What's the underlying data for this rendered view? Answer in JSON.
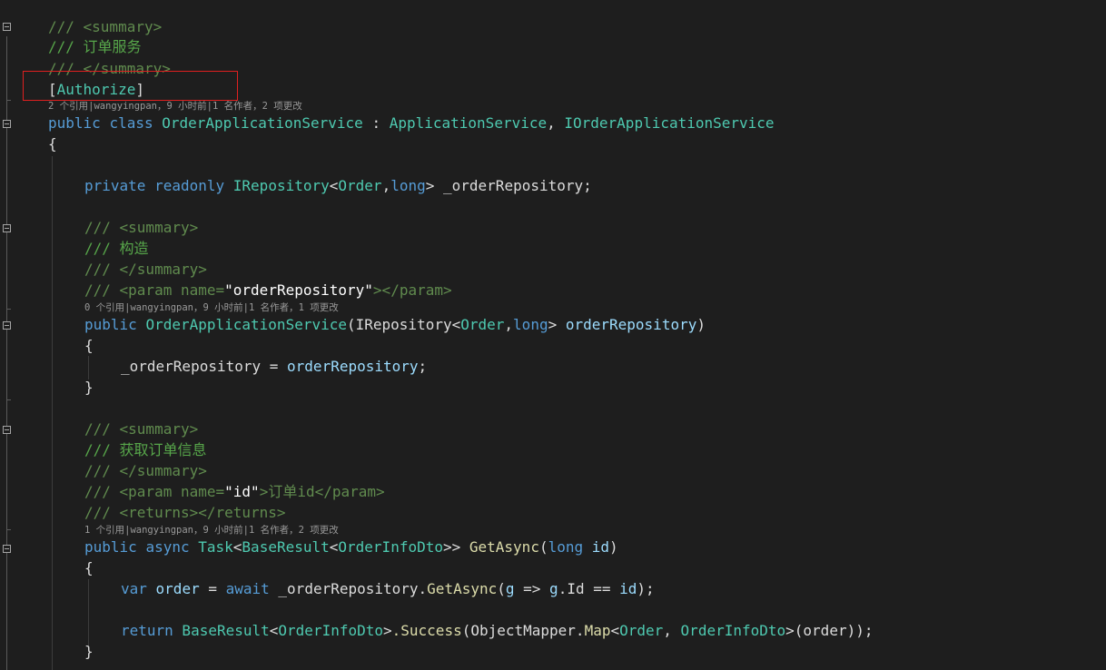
{
  "lines": {
    "l1": "/// <summary>",
    "l2": "/// 订单服务",
    "l3": "/// </summary>",
    "l4": "[Authorize]",
    "lens1": "2 个引用|wangyingpan，9 小时前|1 名作者，2 项更改",
    "l5": {
      "kw1": "public",
      "kw2": "class",
      "name": "OrderApplicationService",
      "sep": " : ",
      "base1": "ApplicationService",
      "comma": ", ",
      "base2": "IOrderApplicationService"
    },
    "l6": "{",
    "l7": {
      "kw1": "private",
      "kw2": "readonly",
      "t1": "IRepository",
      "lt": "<",
      "t2": "Order",
      "c": ",",
      "t3": "long",
      "gt": ">",
      "field": " _orderRepository;"
    },
    "l8": "/// <summary>",
    "l9": "/// 构造",
    "l10": "/// </summary>",
    "l11": {
      "a": "/// <param ",
      "b": "name",
      "c": "=",
      "d": "\"",
      "e": "orderRepository",
      "f": "\"",
      "g": "></param>"
    },
    "lens2": "0 个引用|wangyingpan，9 小时前|1 名作者，1 项更改",
    "l12": {
      "kw1": "public",
      "name": "OrderApplicationService",
      "p1": "(IRepository",
      "lt": "<",
      "t2": "Order",
      "c": ",",
      "t3": "long",
      "gt": ">",
      "param": " orderRepository",
      "close": ")"
    },
    "l13": "{",
    "l14": {
      "lhs": "_orderRepository",
      "eq": " = ",
      "rhs": "orderRepository",
      "end": ";"
    },
    "l15": "}",
    "l16": "/// <summary>",
    "l17": "/// 获取订单信息",
    "l18": "/// </summary>",
    "l19": {
      "a": "/// <param ",
      "b": "name",
      "c": "=",
      "d": "\"",
      "e": "id",
      "f": "\"",
      "g": ">订单id</param>"
    },
    "l20": "/// <returns></returns>",
    "lens3": "1 个引用|wangyingpan，9 小时前|1 名作者，2 项更改",
    "l21": {
      "kw1": "public",
      "kw2": "async",
      "t1": "Task",
      "lt1": "<",
      "t2": "BaseResult",
      "lt2": "<",
      "t3": "OrderInfoDto",
      "gt": ">>",
      "m": " GetAsync",
      "po": "(",
      "kw3": "long",
      "p": " id",
      "pc": ")"
    },
    "l22": "{",
    "l23": {
      "kw1": "var",
      "v": " order",
      "eq": " = ",
      "kw2": "await",
      "f": " _orderRepository.",
      "m": "GetAsync",
      "o": "(",
      "g": "g",
      "arrow": " => ",
      "g2": "g",
      "prop": ".Id == ",
      "id": "id",
      "end": ");"
    },
    "l24": {
      "kw1": "return",
      "t1": " BaseResult",
      "lt": "<",
      "t2": "OrderInfoDto",
      "gt": ">",
      "m": ".Success",
      "o": "(ObjectMapper.",
      "m2": "Map",
      "lt2": "<",
      "t3": "Order",
      "c": ", ",
      "t4": "OrderInfoDto",
      "gt2": ">",
      "args": "(order));"
    },
    "l25": "}"
  }
}
